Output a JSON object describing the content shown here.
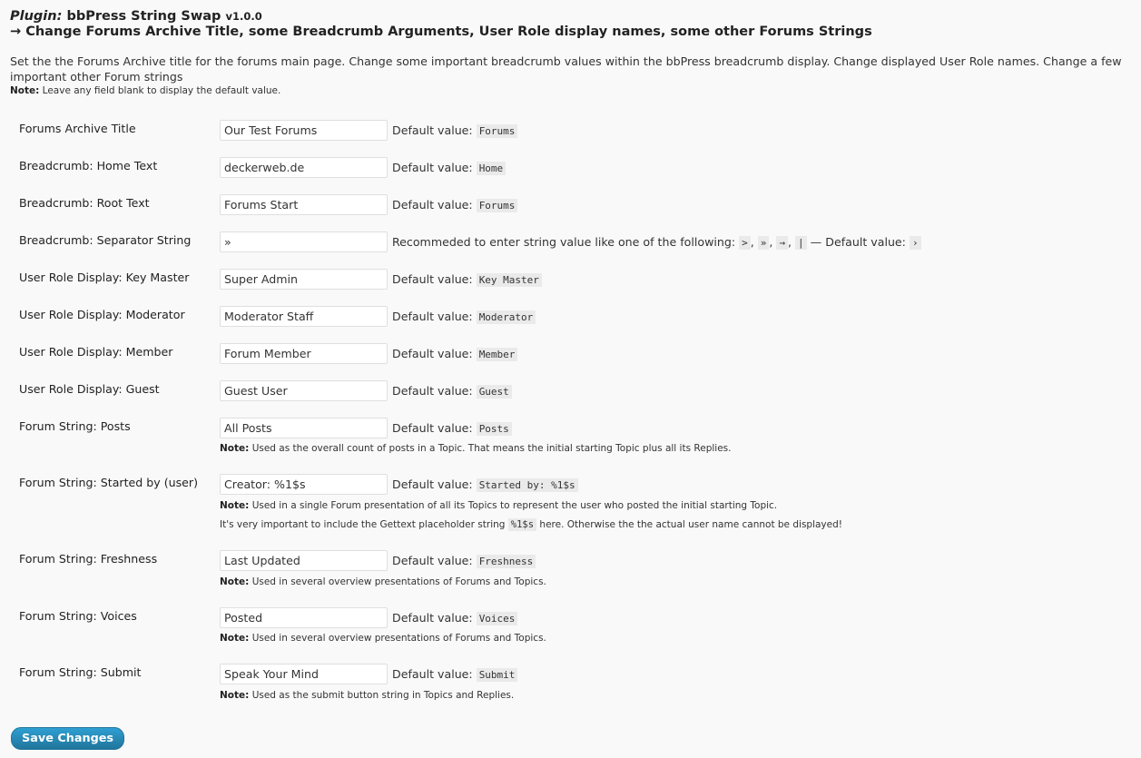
{
  "header": {
    "title_prefix": "Plugin:",
    "title_name": "bbPress String Swap",
    "version": "v1.0.0",
    "subtitle": "→ Change Forums Archive Title, some Breadcrumb Arguments, User Role display names, some other Forums Strings",
    "intro": "Set the the Forums Archive title for the forums main page. Change some important breadcrumb values within the bbPress breadcrumb display. Change displayed User Role names. Change a few important other Forum strings",
    "note_label": "Note:",
    "note_text": " Leave any field blank to display the default value."
  },
  "default_label": "Default value:",
  "fields": [
    {
      "label": "Forums Archive Title",
      "value": "Our Test Forums",
      "default": "Forums"
    },
    {
      "label": "Breadcrumb: Home Text",
      "value": "deckerweb.de",
      "default": "Home"
    },
    {
      "label": "Breadcrumb: Root Text",
      "value": "Forums Start",
      "default": "Forums"
    },
    {
      "label": "Breadcrumb: Separator String",
      "value": "»",
      "desc_pre": "Recommeded to enter string value like one of the following:",
      "options": [
        ">",
        "»",
        "→",
        "|"
      ],
      "desc_post": " — Default value:",
      "default": "›"
    },
    {
      "label": "User Role Display: Key Master",
      "value": "Super Admin",
      "default": "Key Master"
    },
    {
      "label": "User Role Display: Moderator",
      "value": "Moderator Staff",
      "default": "Moderator"
    },
    {
      "label": "User Role Display: Member",
      "value": "Forum Member",
      "default": "Member"
    },
    {
      "label": "User Role Display: Guest",
      "value": "Guest User",
      "default": "Guest"
    },
    {
      "label": "Forum String: Posts",
      "value": "All Posts",
      "default": "Posts",
      "note": "Used as the overall count of posts in a Topic. That means the initial starting Topic plus all its Replies."
    },
    {
      "label": "Forum String: Started by (user)",
      "value": "Creator: %1$s",
      "default": "Started by: %1$s",
      "note": "Used in a single Forum presentation of all its Topics to represent the user who posted the initial starting Topic.",
      "note2_pre": "It's very important to include the Gettext placeholder string ",
      "note2_code": "%1$s",
      "note2_post": " here. Otherwise the the actual user name cannot be displayed!"
    },
    {
      "label": "Forum String: Freshness",
      "value": "Last Updated",
      "default": "Freshness",
      "note": "Used in several overview presentations of Forums and Topics."
    },
    {
      "label": "Forum String: Voices",
      "value": "Posted",
      "default": "Voices",
      "note": "Used in several overview presentations of Forums and Topics."
    },
    {
      "label": "Forum String: Submit",
      "value": "Speak Your Mind",
      "default": "Submit",
      "note": "Used as the submit button string in Topics and Replies."
    }
  ],
  "note_label": "Note:",
  "save_label": "Save Changes"
}
